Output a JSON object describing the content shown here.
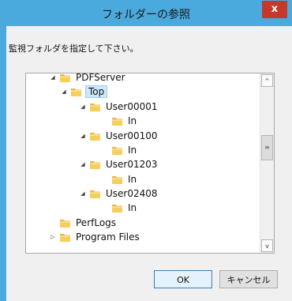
{
  "window": {
    "title": "フォルダーの参照",
    "close_glyph": "x"
  },
  "prompt": "監視フォルダを指定して下さい。",
  "tree": {
    "nodes": [
      {
        "label": "PDFServer",
        "expander": "◢",
        "selected": false
      },
      {
        "label": "Top",
        "expander": "◢",
        "selected": true
      },
      {
        "label": "User00001",
        "expander": "◢",
        "selected": false
      },
      {
        "label": "In",
        "expander": "",
        "selected": false
      },
      {
        "label": "User00100",
        "expander": "◢",
        "selected": false
      },
      {
        "label": "In",
        "expander": "",
        "selected": false
      },
      {
        "label": "User01203",
        "expander": "◢",
        "selected": false
      },
      {
        "label": "In",
        "expander": "",
        "selected": false
      },
      {
        "label": "User02408",
        "expander": "◢",
        "selected": false
      },
      {
        "label": "In",
        "expander": "",
        "selected": false
      },
      {
        "label": "PerfLogs",
        "expander": "",
        "selected": false
      },
      {
        "label": "Program Files",
        "expander": "▷",
        "selected": false
      }
    ],
    "scroll_up": "^",
    "scroll_down": "v",
    "scroll_grip": "≡"
  },
  "buttons": {
    "ok": "OK",
    "cancel": "キャンセル"
  },
  "colors": {
    "title_bg": "#4aa9dd",
    "close_bg": "#c7382c",
    "selection": "#cde8fb"
  }
}
